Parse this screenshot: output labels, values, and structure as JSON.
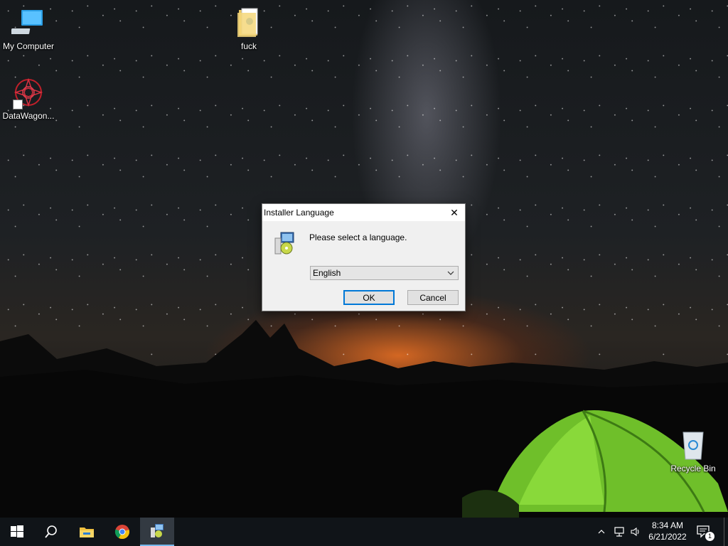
{
  "desktop": {
    "icons": [
      {
        "label": "My Computer",
        "icon": "computer-icon"
      },
      {
        "label": "fuck",
        "icon": "folder-icon"
      },
      {
        "label": "DataWagon...",
        "icon": "app-shortcut-icon"
      },
      {
        "label": "Recycle Bin",
        "icon": "recycle-bin-icon"
      }
    ]
  },
  "dialog": {
    "title": "Installer Language",
    "close_glyph": "✕",
    "message": "Please select a language.",
    "selected_language": "English",
    "ok_label": "OK",
    "cancel_label": "Cancel"
  },
  "taskbar": {
    "pinned": [
      "start-icon",
      "search-icon",
      "file-explorer-icon",
      "chrome-icon",
      "installer-icon"
    ],
    "clock": {
      "time": "8:34 AM",
      "date": "6/21/2022"
    },
    "notification_count": "1"
  },
  "colors": {
    "accent": "#0078d7",
    "taskbar": "#101418",
    "dialog_bg": "#f0f0f0"
  }
}
